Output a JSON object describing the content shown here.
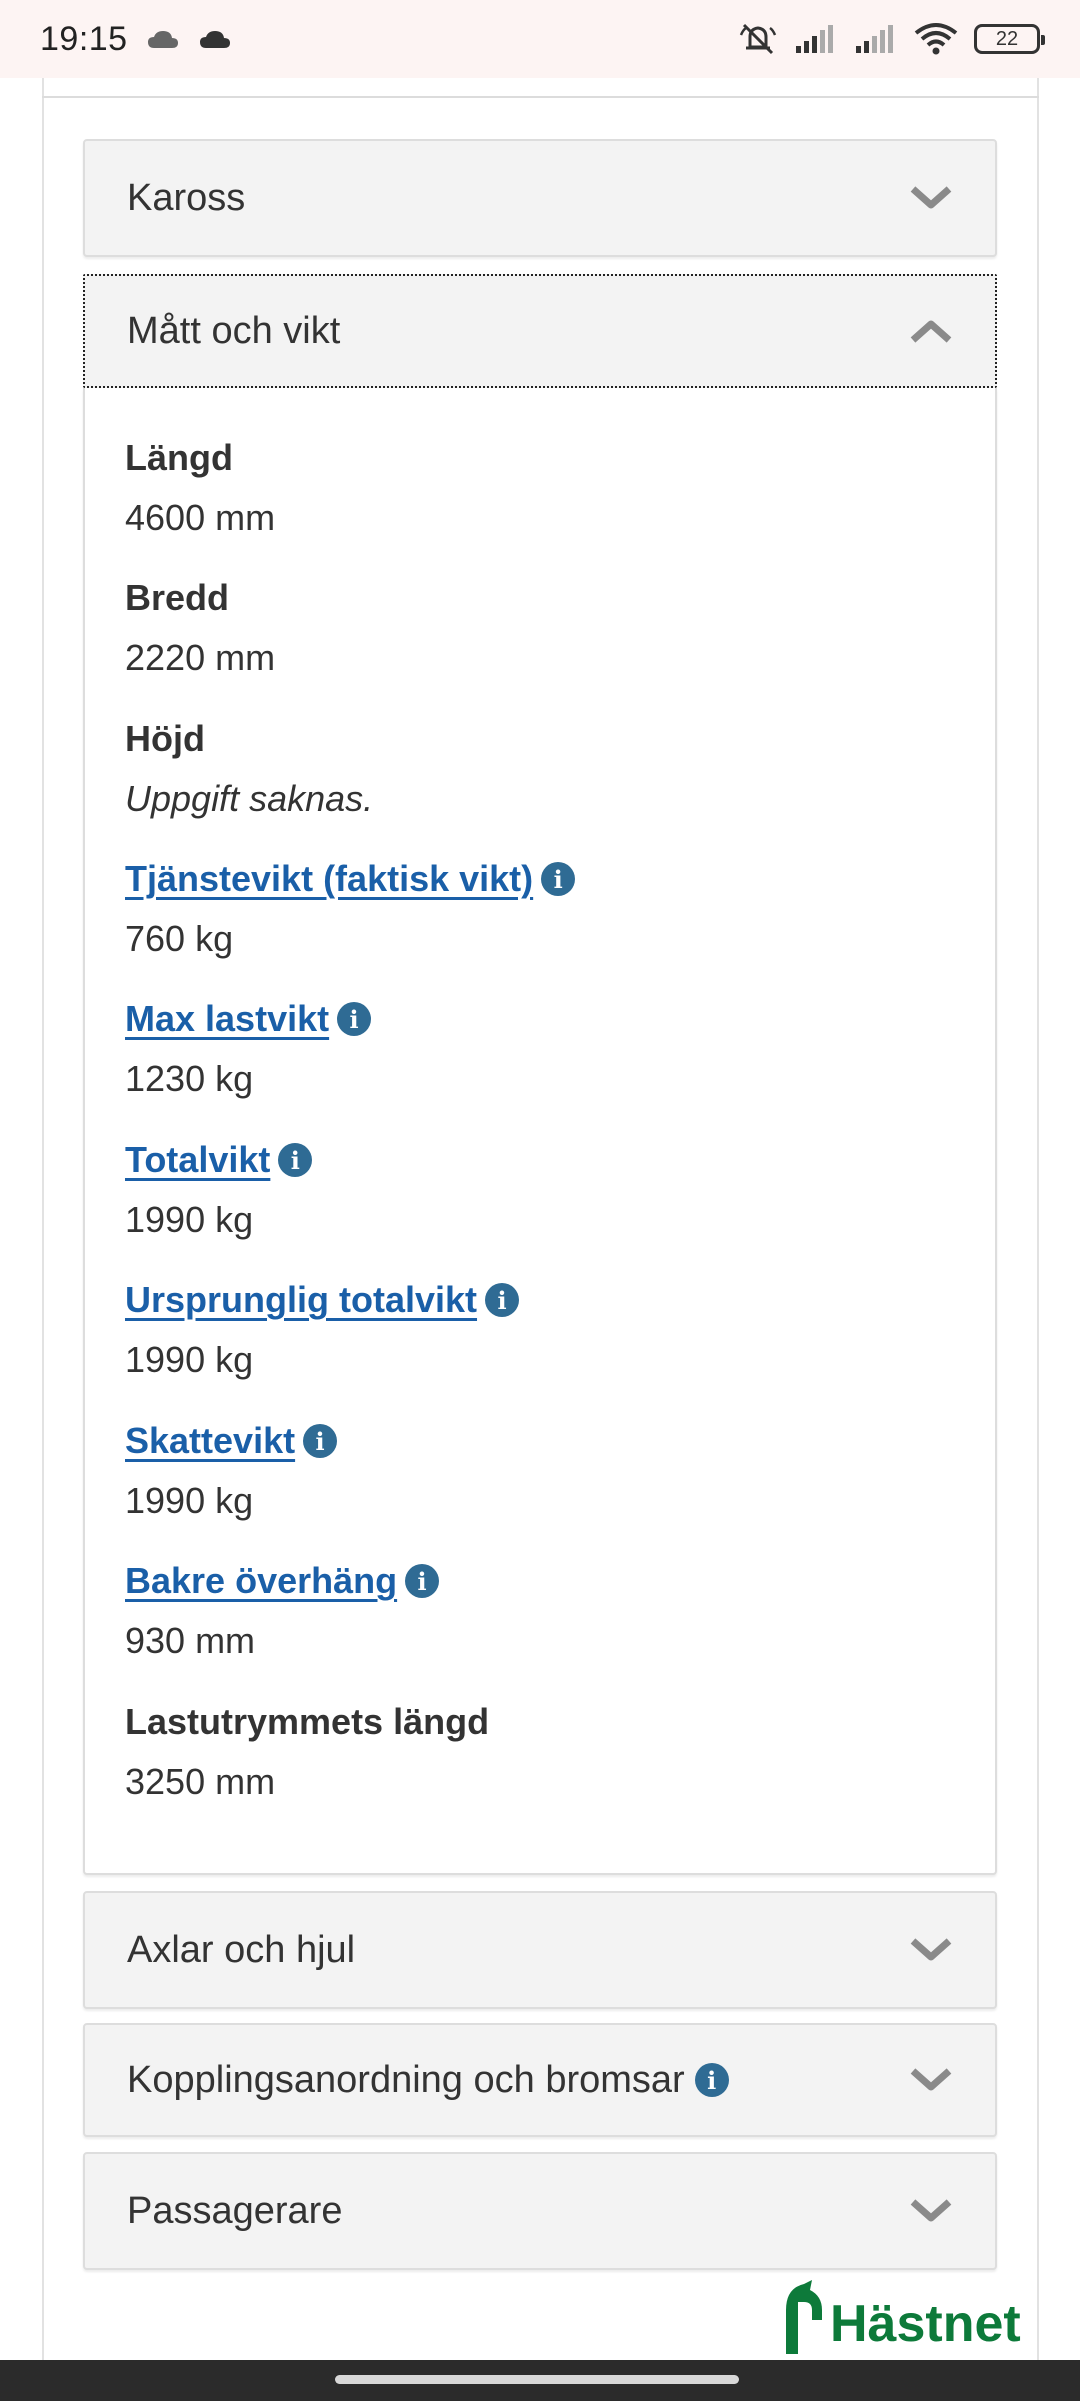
{
  "status_bar": {
    "time": "19:15",
    "battery": "22"
  },
  "accordions": {
    "kaross": {
      "title": "Kaross"
    },
    "matt": {
      "title": "Mått och vikt"
    },
    "axlar": {
      "title": "Axlar och hjul"
    },
    "koppling": {
      "title": "Kopplingsanordning och bromsar"
    },
    "passagerare": {
      "title": "Passagerare"
    }
  },
  "specs": [
    {
      "label": "Längd",
      "value": "4600 mm"
    },
    {
      "label": "Bredd",
      "value": "2220 mm"
    },
    {
      "label": "Höjd",
      "value": "Uppgift saknas."
    },
    {
      "label": "Tjänstevikt (faktisk vikt)",
      "value": "760 kg"
    },
    {
      "label": "Max lastvikt",
      "value": "1230 kg"
    },
    {
      "label": "Totalvikt",
      "value": "1990 kg"
    },
    {
      "label": "Ursprunglig totalvikt",
      "value": "1990 kg"
    },
    {
      "label": "Skattevikt",
      "value": "1990 kg"
    },
    {
      "label": "Bakre överhäng",
      "value": "930 mm"
    },
    {
      "label": "Lastutrymmets längd",
      "value": "3250 mm"
    }
  ],
  "info_icon_glyph": "i",
  "logo": {
    "text": "Hästnet",
    "color": "#0d7a3a"
  },
  "colors": {
    "link": "#1a5fa8",
    "info_icon": "#2f6b94",
    "accordion_bg": "#f3f3f3"
  }
}
